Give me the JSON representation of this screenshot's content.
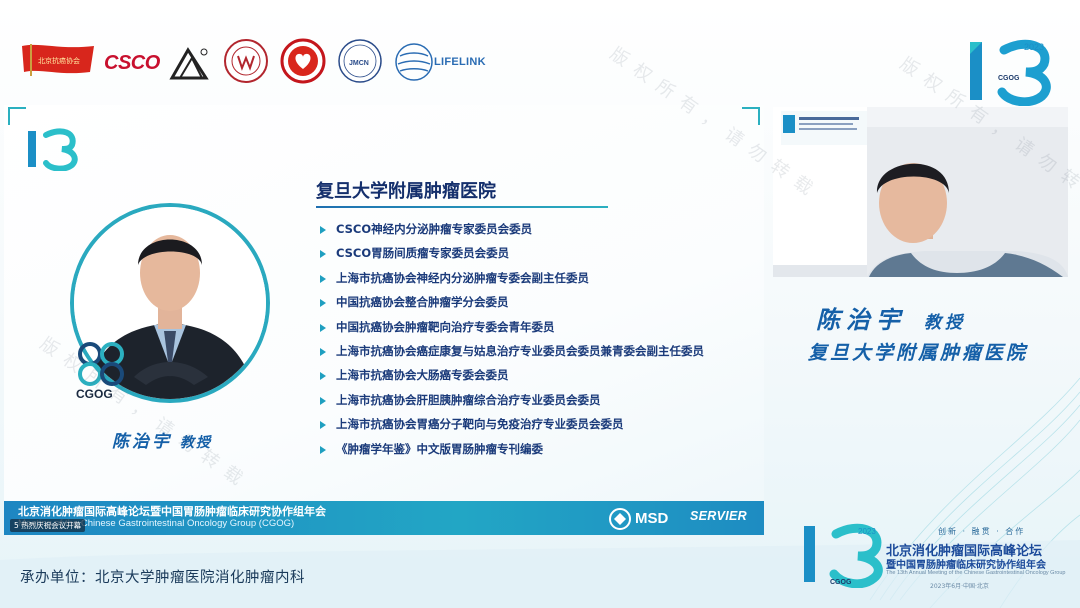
{
  "logos": {
    "flag_label": "北京抗癌协会",
    "csco_label": "CSCO",
    "lifelink_label": "LIFELINK",
    "jmcn_label": "JMCN"
  },
  "slide": {
    "hospital": "复旦大学附属肿瘤医院",
    "roles": [
      "CSCO神经内分泌肿瘤专家委员会委员",
      "CSCO胃肠间质瘤专家委员会委员",
      "上海市抗癌协会神经内分泌肿瘤专委会副主任委员",
      "中国抗癌协会整合肿瘤学分会委员",
      "中国抗癌协会肿瘤靶向治疗专委会青年委员",
      "上海市抗癌协会癌症康复与姑息治疗专业委员会委员兼青委会副主任委员",
      "上海市抗癌协会大肠癌专委会委员",
      "上海市抗癌协会肝胆胰肿瘤综合治疗专业委员会委员",
      "上海市抗癌协会胃癌分子靶向与免疫治疗专业委员会委员",
      "《肿瘤学年鉴》中文版胃肠肿瘤专刊编委"
    ],
    "speaker_name": "陈治宇",
    "speaker_title": "教授",
    "badge": "CGOG",
    "footer_cn": "北京消化肿瘤国际高峰论坛暨中国胃肠肿瘤临床研究协作组年会",
    "footer_en": "Meeting of the Chinese Gastrointestinal Oncology Group (CGOG)",
    "footer_live": "5 热烈庆祝会议开幕",
    "sponsor_1": "MSD",
    "sponsor_2": "SERVIER"
  },
  "video": {
    "name": "陈治宇",
    "title": "教授",
    "hospital": "复旦大学附属肿瘤医院"
  },
  "event": {
    "tags": "创新 · 融贯 · 合作",
    "title_cn_1": "北京消化肿瘤国际高峰论坛",
    "title_cn_2": "暨中国胃肠肿瘤临床研究协作组年会",
    "title_en": "The 13th Annual Meeting of the Chinese Gastrointestinal Oncology Group",
    "date": "2023年6月·中国·北京",
    "number": "13",
    "year": "2023",
    "brand": "CGOG"
  },
  "organizer": "承办单位：北京大学肿瘤医院消化肿瘤内科",
  "watermark": "版权所有，请勿转载",
  "colors": {
    "accent_teal": "#2aa9bf",
    "accent_blue": "#1560a8",
    "footer_blue": "#1e86c2",
    "text_navy": "#142f6c"
  }
}
